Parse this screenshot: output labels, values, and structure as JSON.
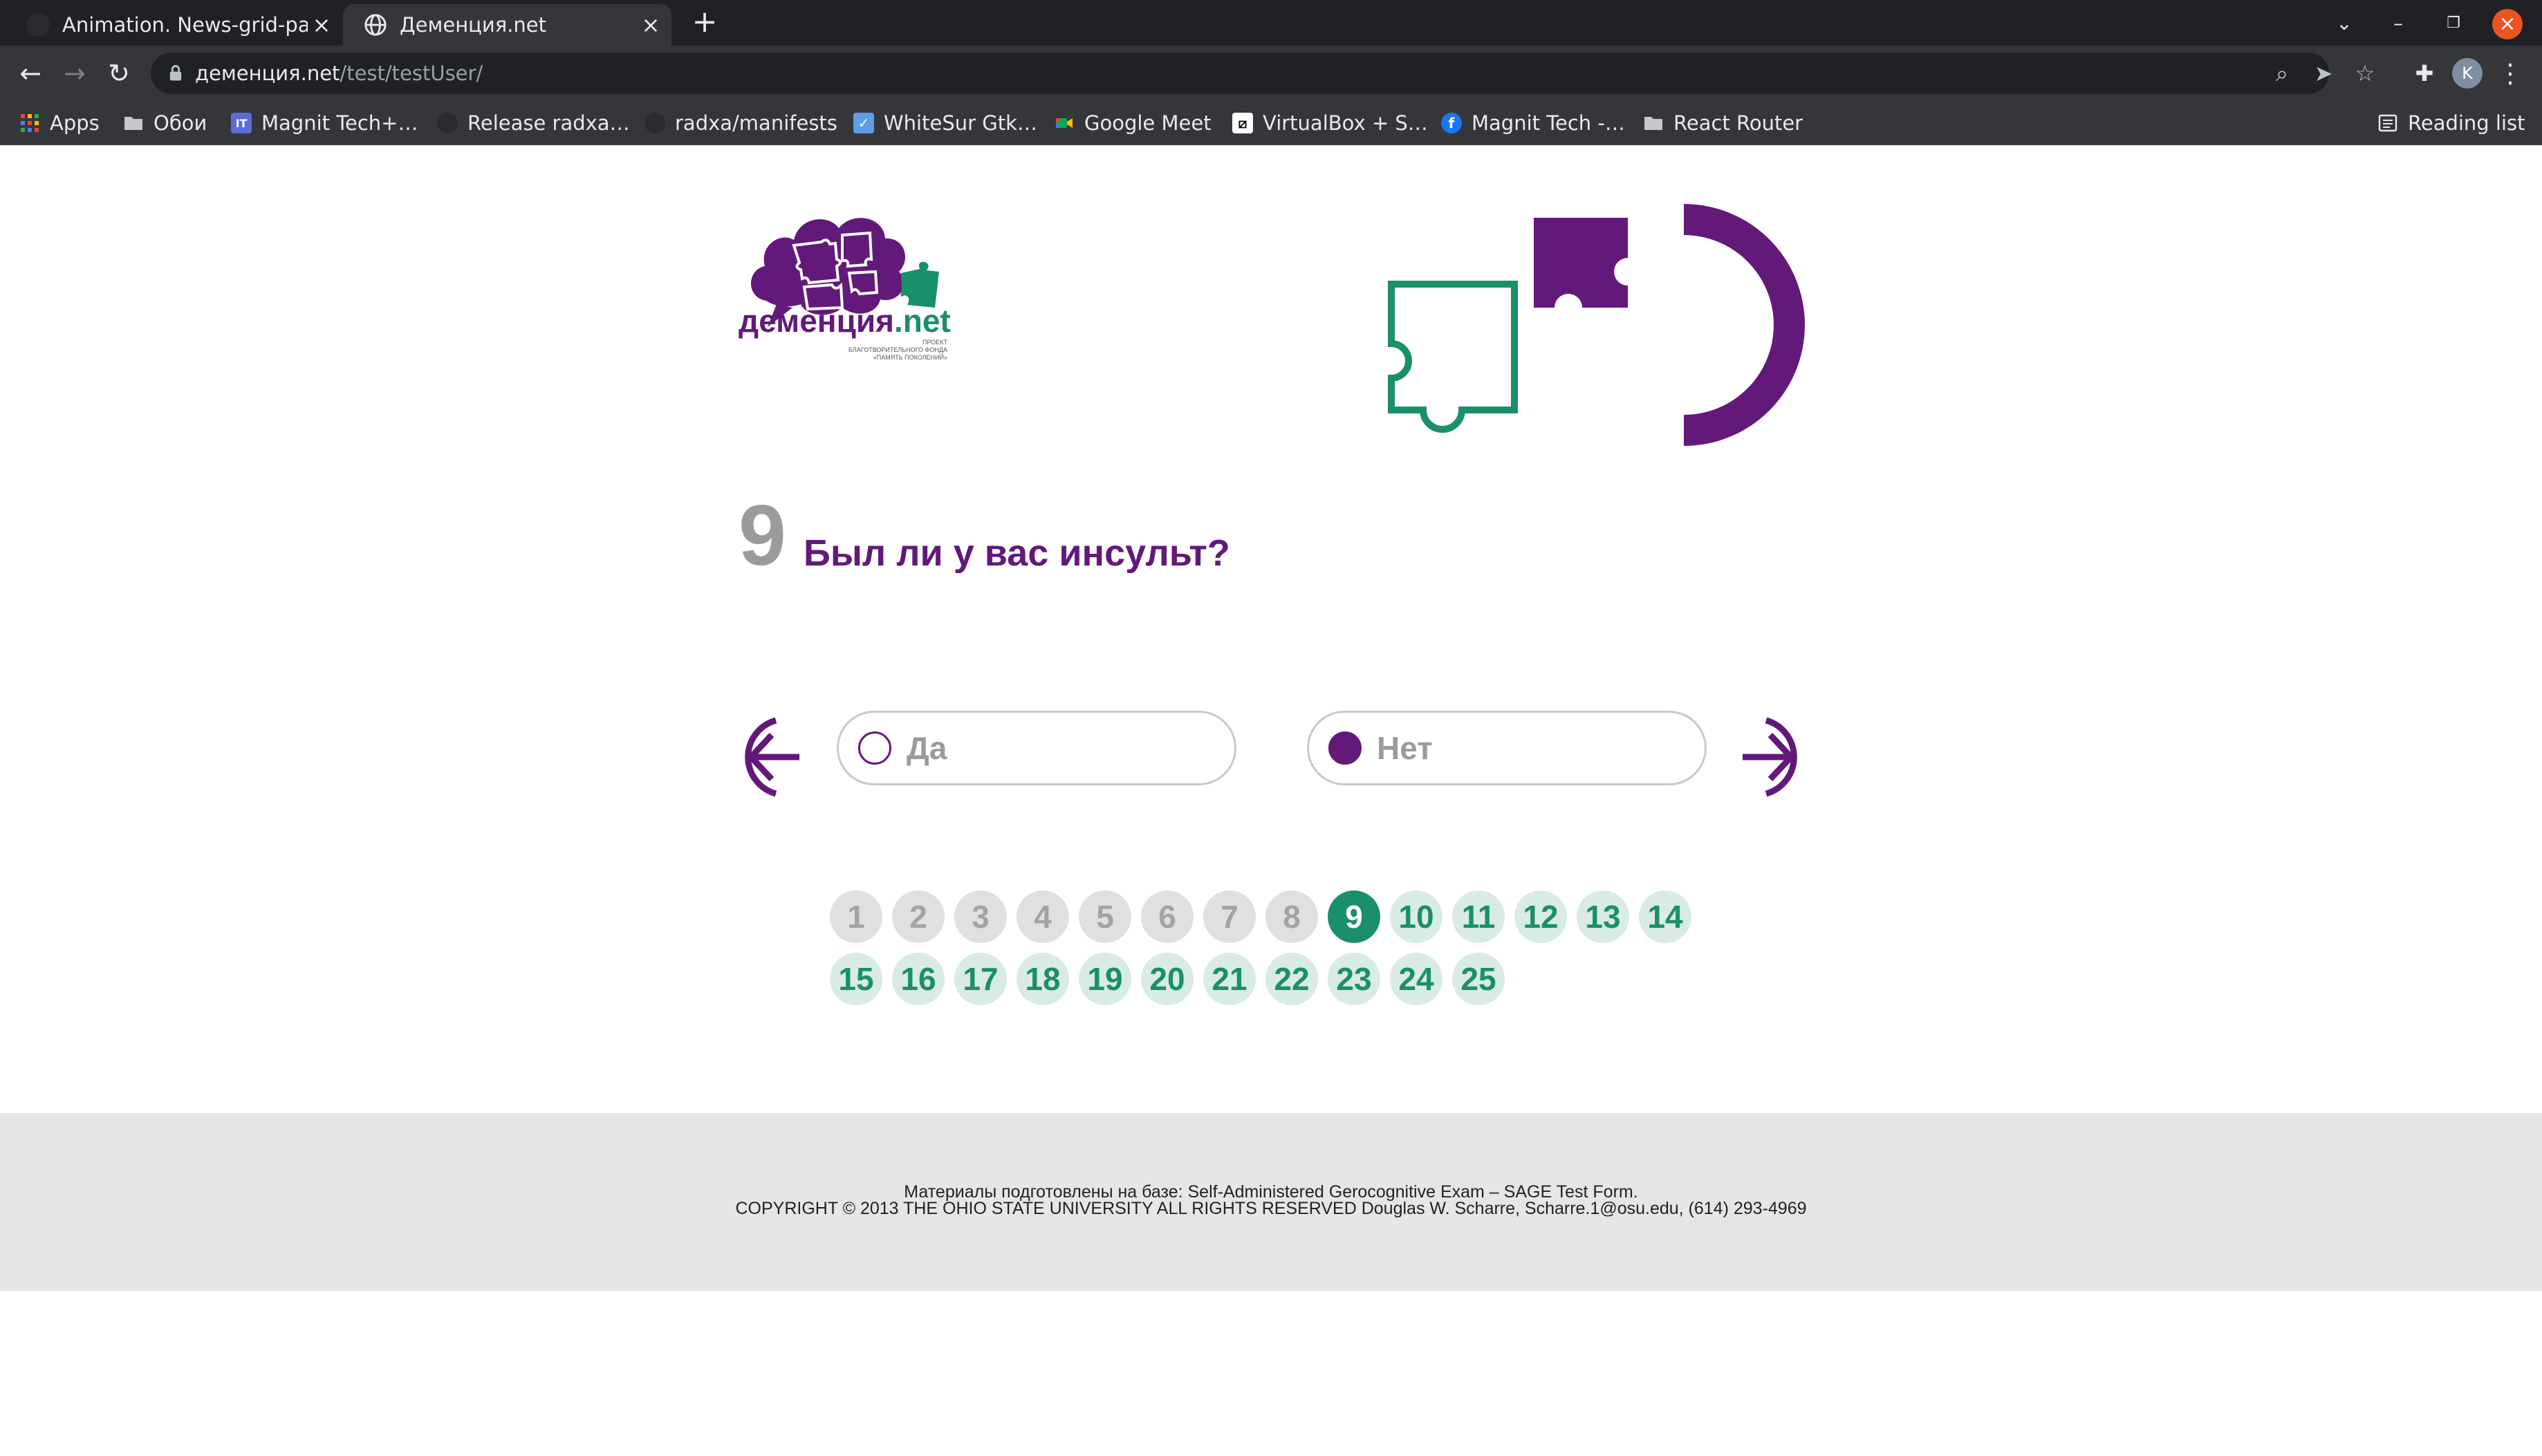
{
  "browser": {
    "tabs": [
      {
        "title": "Animation. News-grid-page",
        "active": false
      },
      {
        "title": "Деменция.net",
        "active": true
      }
    ],
    "new_tab_label": "+",
    "url_host": "деменция.net",
    "url_path": "/test/testUser/",
    "avatar_initial": "K",
    "bookmarks": [
      {
        "label": "Apps",
        "icon": "apps-grid-icon"
      },
      {
        "label": "Обои",
        "icon": "folder-icon"
      },
      {
        "label": "Magnit Tech+…",
        "icon": "it-logo-icon"
      },
      {
        "label": "Release radxa…",
        "icon": "github-icon"
      },
      {
        "label": "radxa/manifests",
        "icon": "github-icon"
      },
      {
        "label": "WhiteSur Gtk…",
        "icon": "whitesur-icon"
      },
      {
        "label": "Google Meet",
        "icon": "google-meet-icon"
      },
      {
        "label": "VirtualBox + S…",
        "icon": "slashed-box-icon"
      },
      {
        "label": "Magnit Tech -…",
        "icon": "facebook-icon"
      },
      {
        "label": "React Router",
        "icon": "folder-icon"
      }
    ],
    "reading_list_label": "Reading list"
  },
  "logo": {
    "brand_main": "деменция",
    "brand_suffix": ".net",
    "tagline_1": "ПРОЕКТ",
    "tagline_2": "БЛАГОТВОРИТЕЛЬНОГО ФОНДА",
    "tagline_3": "«ПАМЯТЬ ПОКОЛЕНИЙ»"
  },
  "question": {
    "number": "9",
    "text": "Был ли у вас инсульт?"
  },
  "answers": [
    {
      "label": "Да",
      "selected": false
    },
    {
      "label": "Нет",
      "selected": true
    }
  ],
  "pagination": {
    "current": 9,
    "pages": [
      "1",
      "2",
      "3",
      "4",
      "5",
      "6",
      "7",
      "8",
      "9",
      "10",
      "11",
      "12",
      "13",
      "14",
      "15",
      "16",
      "17",
      "18",
      "19",
      "20",
      "21",
      "22",
      "23",
      "24",
      "25"
    ]
  },
  "footer": {
    "line1": "Материалы подготовлены на базе: Self-Administered Gerocognitive Exam – SAGE Test Form.",
    "line2": "COPYRIGHT © 2013 THE OHIO STATE UNIVERSITY ALL RIGHTS RESERVED Douglas W. Scharre, Scharre.1@osu.edu, (614) 293-4969"
  },
  "colors": {
    "brand_purple": "#63197a",
    "brand_green": "#1a8f6c",
    "muted_gray": "#9b9b9b"
  }
}
